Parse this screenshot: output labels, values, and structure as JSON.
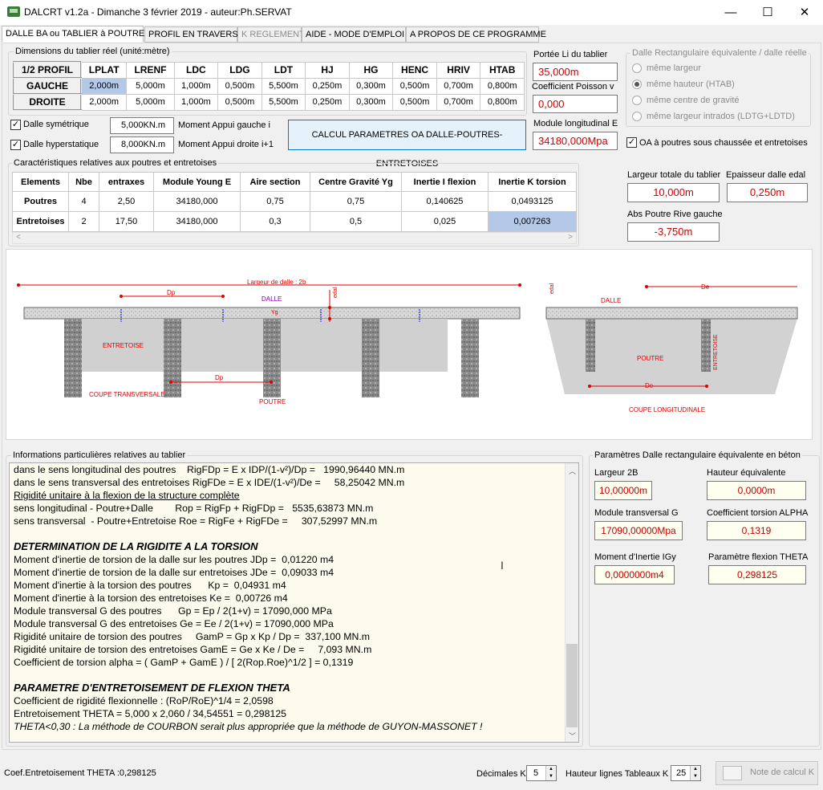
{
  "window": {
    "title": "DALCRT v1.2a - Dimanche 3 février 2019 - auteur:Ph.SERVAT",
    "minimize": "—",
    "maximize": "☐",
    "close": "✕"
  },
  "tabs": [
    {
      "label": "DALLE BA ou TABLIER à POUTRES"
    },
    {
      "label": "PROFIL EN TRAVERS"
    },
    {
      "label": "K REGLEMENT"
    },
    {
      "label": "AIDE - MODE D'EMPLOI"
    },
    {
      "label": "A PROPOS DE CE PROGRAMME"
    }
  ],
  "dimensions": {
    "group_label": "Dimensions du tablier réel (unité:mètre)",
    "headers": [
      "1/2 PROFIL",
      "LPLAT",
      "LRENF",
      "LDC",
      "LDG",
      "LDT",
      "HJ",
      "HG",
      "HENC",
      "HRIV",
      "HTAB"
    ],
    "rows": [
      {
        "name": "GAUCHE",
        "values": [
          "2,000m",
          "5,000m",
          "1,000m",
          "0,500m",
          "5,500m",
          "0,250m",
          "0,300m",
          "0,500m",
          "0,700m",
          "0,800m"
        ]
      },
      {
        "name": "DROITE",
        "values": [
          "2,000m",
          "5,000m",
          "1,000m",
          "0,500m",
          "5,500m",
          "0,250m",
          "0,300m",
          "0,500m",
          "0,700m",
          "0,800m"
        ]
      }
    ]
  },
  "options": {
    "dalle_symetrique": "Dalle symétrique",
    "dalle_hyperstatique": "Dalle hyperstatique",
    "moment_gauche_value": "5,000KN.m",
    "moment_gauche_label": "Moment Appui gauche i",
    "moment_droite_value": "8,000KN.m",
    "moment_droite_label": "Moment Appui droite i+1",
    "calc_button": "CALCUL PARAMETRES OA DALLE-POUTRES-ENTRETOISES"
  },
  "portee": {
    "portee_label": "Portée Li du tablier",
    "portee_value": "35,000m",
    "poisson_label": "Coefficient Poisson v",
    "poisson_value": "0,000",
    "module_label": "Module longitudinal E",
    "module_value": "34180,000Mpa"
  },
  "dalle_rect": {
    "group_label": "Dalle Rectangulaire équivalente / dalle réelle",
    "options": [
      "même largeur",
      "même hauteur (HTAB)",
      "même centre de gravité",
      "même largeur intrados (LDTG+LDTD)"
    ],
    "oa_label": "OA à poutres sous chaussée et entretoises"
  },
  "caract": {
    "group_label": "Caractéristiques relatives aux poutres et entretoises",
    "headers": [
      "Elements",
      "Nbe",
      "entraxes",
      "Module Young E",
      "Aire section",
      "Centre Gravité Yg",
      "Inertie I flexion",
      "Inertie K torsion"
    ],
    "rows": [
      {
        "name": "Poutres",
        "values": [
          "4",
          "2,50",
          "34180,000",
          "0,75",
          "0,75",
          "0,140625",
          "0,0493125"
        ]
      },
      {
        "name": "Entretoises",
        "values": [
          "2",
          "17,50",
          "34180,000",
          "0,3",
          "0,5",
          "0,025",
          "0,007263"
        ]
      }
    ]
  },
  "tablier": {
    "largeur_label": "Largeur totale du tablier",
    "largeur_value": "10,000m",
    "epaisseur_label": "Epaisseur dalle edal",
    "epaisseur_value": "0,250m",
    "abs_label": "Abs Poutre Rive gauche",
    "abs_value": "-3,750m"
  },
  "drawing": {
    "largeur": "Largeur de dalle : 2b",
    "dp": "Dp",
    "dalle": "DALLE",
    "yg": "Yg",
    "edal": "edal",
    "entretoise": "ENTRETOISE",
    "coupe_transversale": "COUPE TRANSVERSALE",
    "poutre": "POUTRE",
    "de": "De",
    "entretoise_v": "ENTRETOISE",
    "coupe_longitudinale": "COUPE LONGITUDINALE"
  },
  "info": {
    "group_label": "Informations particulières relatives au tablier",
    "lines": [
      {
        "t": "dans le sens longitudinal des poutres    RigFDp = E x IDP/(1-v²)/Dp =   1990,96440 MN.m",
        "s": ""
      },
      {
        "t": "dans le sens transversal des entretoises RigFDe = E x IDE/(1-v²)/De =     58,25042 MN.m",
        "s": ""
      },
      {
        "t": "Rigidité unitaire à la flexion de la structure complète",
        "s": "u"
      },
      {
        "t": "sens longitudinal - Poutre+Dalle        Rop = RigFp + RigFDp =   5535,63873 MN.m",
        "s": ""
      },
      {
        "t": "sens transversal  - Poutre+Entretoise Roe = RigFe + RigFDe =     307,52997 MN.m",
        "s": ""
      },
      {
        "t": "",
        "s": ""
      },
      {
        "t": "DETERMINATION DE LA RIGIDITE A LA TORSION",
        "s": "b"
      },
      {
        "t": "Moment d'inertie de torsion de la dalle sur les poutres JDp =  0,01220 m4",
        "s": ""
      },
      {
        "t": "Moment d'inertie de torsion de la dalle sur entretoises JDe =  0,09033 m4",
        "s": ""
      },
      {
        "t": "Moment d'inertie à la torsion des poutres      Kp =  0,04931 m4",
        "s": ""
      },
      {
        "t": "Moment d'inertie à la torsion des entretoises Ke =  0,00726 m4",
        "s": ""
      },
      {
        "t": "Module transversal G des poutres      Gp = Ep / 2(1+v) = 17090,000 MPa",
        "s": ""
      },
      {
        "t": "Module transversal G des entretoises Ge = Ee / 2(1+v) = 17090,000 MPa",
        "s": ""
      },
      {
        "t": "Rigidité unitaire de torsion des poutres     GamP = Gp x Kp / Dp =  337,100 MN.m",
        "s": ""
      },
      {
        "t": "Rigidité unitaire de torsion des entretoises GamE = Ge x Ke / De =     7,093 MN.m",
        "s": ""
      },
      {
        "t": "Coefficient de torsion alpha = ( GamP + GamE ) / [ 2(Rop.Roe)^1/2 ] = 0,1319",
        "s": ""
      },
      {
        "t": "",
        "s": ""
      },
      {
        "t": "PARAMETRE D'ENTRETOISEMENT DE FLEXION THETA",
        "s": "b"
      },
      {
        "t": "Coefficient de rigidité flexionnelle : (RoP/RoE)^1/4 = 2,0598",
        "s": ""
      },
      {
        "t": "Entretoisement THETA = 5,000 x 2,060 / 34,54551 = 0,298125",
        "s": ""
      },
      {
        "t": "THETA<0,30 : La méthode de COURBON serait plus appropriée que la méthode de GUYON-MASSONET !",
        "s": "i"
      }
    ]
  },
  "param": {
    "group_label": "Paramètres Dalle rectangulaire  équivalente en béton",
    "largeur_label": "Largeur 2B",
    "largeur_value": "10,00000m",
    "hauteur_label": "Hauteur équivalente",
    "hauteur_value": "0,0000m",
    "module_label": "Module transversal  G",
    "module_value": "17090,00000Mpa",
    "coef_label": "Coefficient torsion ALPHA",
    "coef_value": "0,1319",
    "moment_label": "Moment d'Inertie IGy",
    "moment_value": "0,0000000m4",
    "theta_label": "Paramètre flexion THETA",
    "theta_value": "0,298125"
  },
  "status": {
    "text": "Coef.Entretoisement THETA :0,298125",
    "decimales_label": "Décimales K",
    "decimales_value": "5",
    "hauteur_label": "Hauteur lignes Tableaux K",
    "hauteur_value": "25",
    "note_button": "Note de calcul K"
  }
}
